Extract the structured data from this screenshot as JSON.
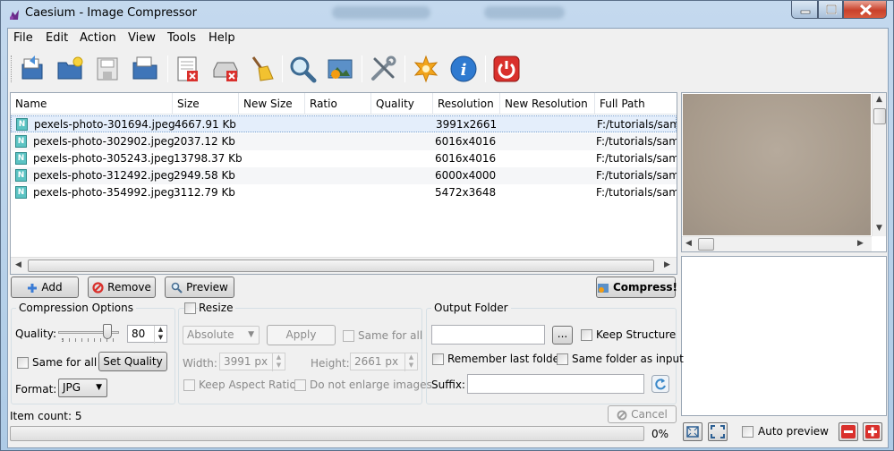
{
  "window": {
    "title": "Caesium - Image Compressor",
    "controls": {
      "minimize": "minimize",
      "maximize": "maximize",
      "close": "close"
    }
  },
  "menu": [
    "File",
    "Edit",
    "Action",
    "View",
    "Tools",
    "Help"
  ],
  "toolbar": {
    "icons": [
      "open-files-icon",
      "open-folder-icon",
      "save-list-icon",
      "save-as-icon",
      "remove-item-icon",
      "clear-list-icon",
      "clean-broom-icon",
      "search-icon",
      "preview-image-icon",
      "settings-tools-icon",
      "plugins-star-icon",
      "info-icon",
      "power-exit-icon"
    ]
  },
  "list": {
    "headers": [
      "Name",
      "Size",
      "New Size",
      "Ratio",
      "Quality",
      "Resolution",
      "New Resolution",
      "Full Path"
    ],
    "rows": [
      {
        "name": "pexels-photo-301694.jpeg",
        "size": "4667.91 Kb",
        "new_size": "",
        "ratio": "",
        "quality": "",
        "resolution": "3991x2661",
        "new_resolution": "",
        "path": "F:/tutorials/sam"
      },
      {
        "name": "pexels-photo-302902.jpeg",
        "size": "2037.12 Kb",
        "new_size": "",
        "ratio": "",
        "quality": "",
        "resolution": "6016x4016",
        "new_resolution": "",
        "path": "F:/tutorials/sam"
      },
      {
        "name": "pexels-photo-305243.jpeg",
        "size": "13798.37 Kb",
        "new_size": "",
        "ratio": "",
        "quality": "",
        "resolution": "6016x4016",
        "new_resolution": "",
        "path": "F:/tutorials/sam"
      },
      {
        "name": "pexels-photo-312492.jpeg",
        "size": "2949.58 Kb",
        "new_size": "",
        "ratio": "",
        "quality": "",
        "resolution": "6000x4000",
        "new_resolution": "",
        "path": "F:/tutorials/sam"
      },
      {
        "name": "pexels-photo-354992.jpeg",
        "size": "3112.79 Kb",
        "new_size": "",
        "ratio": "",
        "quality": "",
        "resolution": "5472x3648",
        "new_resolution": "",
        "path": "F:/tutorials/sam"
      }
    ],
    "file_icon_glyph": "N"
  },
  "actions": {
    "add": "Add",
    "remove": "Remove",
    "preview": "Preview",
    "compress": "Compress!"
  },
  "compression": {
    "title": "Compression Options",
    "quality_label": "Quality:",
    "quality_value": "80",
    "same_for_all": "Same for all",
    "set_quality": "Set Quality",
    "format_label": "Format:",
    "format_value": "JPG"
  },
  "resize": {
    "title": "Resize",
    "mode": "Absolute",
    "apply": "Apply",
    "same_for_all": "Same for all",
    "width_label": "Width:",
    "width_value": "3991 px",
    "height_label": "Height:",
    "height_value": "2661 px",
    "keep_aspect": "Keep Aspect Ratio",
    "no_enlarge": "Do not enlarge images"
  },
  "output": {
    "title": "Output Folder",
    "folder_value": "",
    "browse": "...",
    "keep_structure": "Keep Structure",
    "remember_last": "Remember last folder",
    "same_folder": "Same folder as input",
    "suffix_label": "Suffix:",
    "suffix_value": ""
  },
  "status": {
    "item_count": "Item count: 5",
    "cancel": "Cancel",
    "progress_percent": "0%",
    "progress_value": 0
  },
  "preview": {
    "auto_preview": "Auto preview"
  },
  "colors": {
    "title_bar": "#c4d9ee",
    "selection": "#e4eefb",
    "close_red": "#c9412b",
    "accent_blue": "#3a7bd5"
  }
}
